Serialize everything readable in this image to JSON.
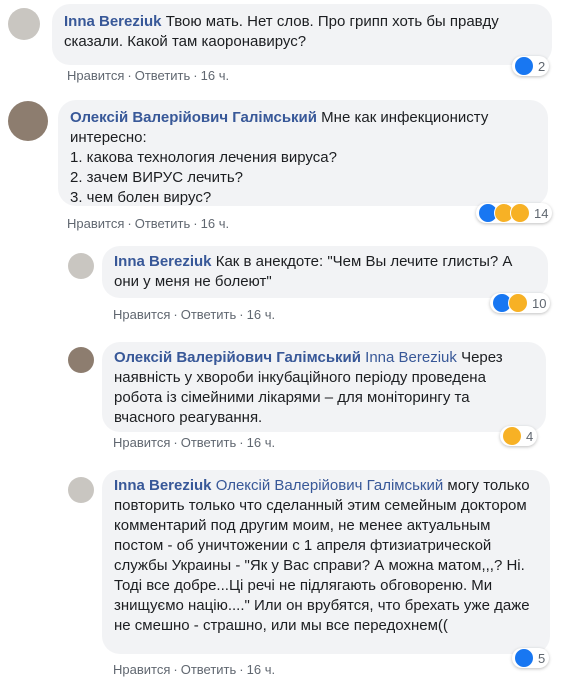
{
  "comments": [
    {
      "author": "Inna Bereziuk",
      "mention": "",
      "text": "Твою мать. Нет слов. Про грипп хоть бы правду сказали. Какой там каоронавирус?",
      "actions": {
        "like": "Нравится",
        "reply": "Ответить",
        "time": "16 ч."
      },
      "reactions": {
        "count": "2",
        "icons": [
          "like-icon"
        ]
      }
    },
    {
      "author": "Олексій Валерійович Галімський",
      "mention": "",
      "text_lines": [
        "Мне как инфекционисту",
        "интересно:",
        "1. какова технология лечения вируса?",
        "2. зачем ВИРУС лечить?",
        "3. чем болен вирус?"
      ],
      "actions": {
        "like": "Нравится",
        "reply": "Ответить",
        "time": "16 ч."
      },
      "reactions": {
        "count": "14",
        "icons": [
          "like-icon",
          "haha-icon",
          "wow-icon"
        ]
      }
    },
    {
      "author": "Inna Bereziuk",
      "mention": "",
      "text": "Как в анекдоте: \"Чем Вы лечите глисты? А они у меня не болеют\"",
      "actions": {
        "like": "Нравится",
        "reply": "Ответить",
        "time": "16 ч."
      },
      "reactions": {
        "count": "10",
        "icons": [
          "like-icon",
          "haha-icon"
        ]
      }
    },
    {
      "author": "Олексій Валерійович Галімський",
      "mention": "Inna Bereziuk",
      "text": "Через наявність у хвороби інкубаційного періоду проведена робота із сімейними лікарями – для моніторингу та вчасного реагування.",
      "actions": {
        "like": "Нравится",
        "reply": "Ответить",
        "time": "16 ч."
      },
      "reactions": {
        "count": "4",
        "icons": [
          "haha-icon"
        ]
      }
    },
    {
      "author": "Inna Bereziuk",
      "mention": "Олексій Валерійович Галімський",
      "text": "могу только повторить только что сделанный этим семейным доктором комментарий под другим моим, не менее актуальным постом - об уничтожении с 1 апреля фтизиатрической службы Украины - \"Як у Вас справи? А можна матом,,,? Ні. Тоді все добре...Ці речі не підлягають обговореню. Ми знищуємо націю....\" Или он врубятся, что брехать уже даже не смешно - страшно, или мы все передохнем((",
      "actions": {
        "like": "Нравится",
        "reply": "Ответить",
        "time": "16 ч."
      },
      "reactions": {
        "count": "5",
        "icons": [
          "like-icon"
        ]
      }
    }
  ]
}
